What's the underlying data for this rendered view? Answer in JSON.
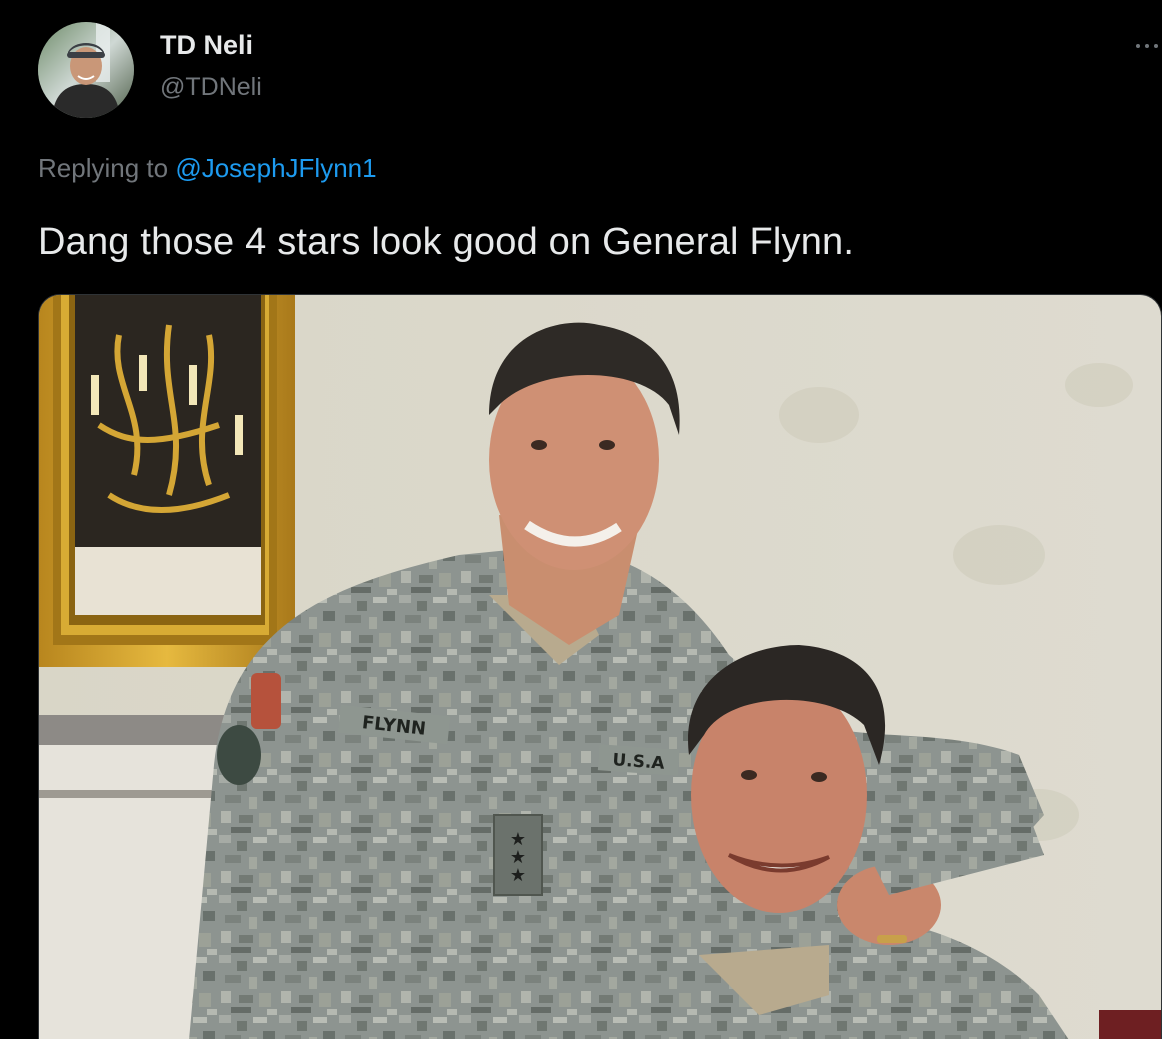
{
  "tweet": {
    "author_name": "TD Neli",
    "author_handle": "@TDNeli",
    "replying_prefix": "Replying to",
    "replying_to": "@JosephJFlynn1",
    "text": "Dang those 4 stars look good on General Flynn.",
    "more_icon": "more-horizontal-icon"
  },
  "media": {
    "type": "photo",
    "uniform_name_tape": "FLYNN",
    "uniform_branch_tape": "U.S.A"
  },
  "colors": {
    "background": "#000000",
    "primary_text": "#e7e9ea",
    "secondary_text": "#71767b",
    "link": "#1d9bf0"
  }
}
